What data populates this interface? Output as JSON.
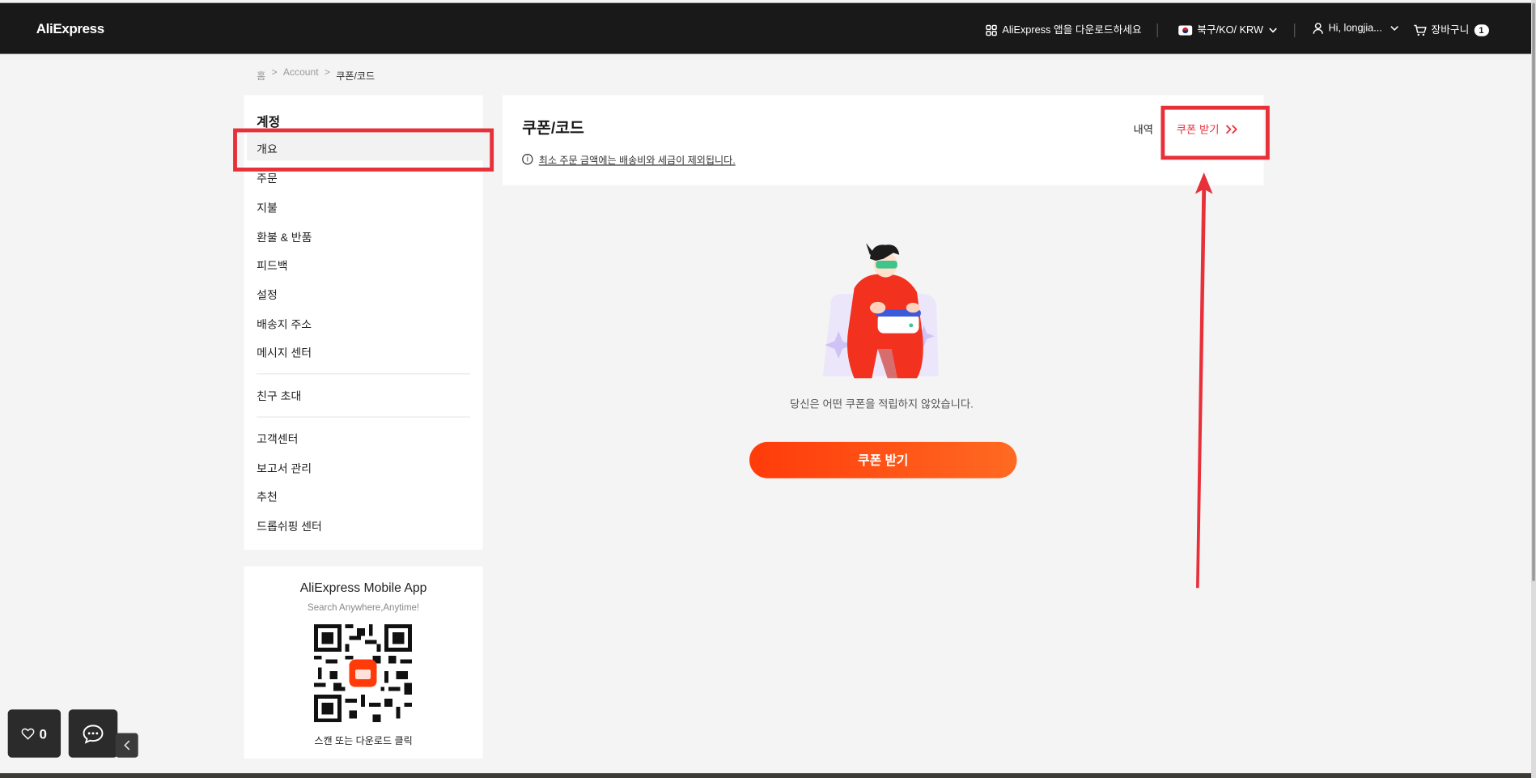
{
  "header": {
    "logo": "AliExpress",
    "app_download": "AliExpress 앱을 다운로드하세요",
    "locale": "북구/KO/ KRW",
    "user_greeting": "Hi, longjia...",
    "cart_label": "장바구니",
    "cart_count": "1"
  },
  "breadcrumb": {
    "home": "홈",
    "sep": ">",
    "account": "Account",
    "current": "쿠폰/코드"
  },
  "sidebar": {
    "title": "계정",
    "items": [
      "개요",
      "주문",
      "지불",
      "환불 & 반품",
      "피드백",
      "설정",
      "배송지 주소",
      "메시지 센터"
    ],
    "group2": [
      "친구 초대"
    ],
    "group3": [
      "고객센터",
      "보고서 관리",
      "추천",
      "드롭쉬핑 센터"
    ]
  },
  "app_promo": {
    "title": "AliExpress Mobile App",
    "subtitle": "Search Anywhere,Anytime!",
    "scan_text": "스캔 또는 다운로드 클릭"
  },
  "main": {
    "title": "쿠폰/코드",
    "notice": "최소 주문 금액에는 배송비와 세금이 제외됩니다.",
    "history_link": "내역",
    "get_coupon_link": "쿠폰 받기",
    "empty_message": "당신은 어떤 쿠폰을 적립하지 않았습니다.",
    "get_coupon_button": "쿠폰 받기"
  },
  "floating": {
    "wishlist_count": "0"
  },
  "colors": {
    "brand_red": "#e8303a",
    "header_bg": "#191919",
    "cta_start": "#ff3b0a",
    "cta_end": "#ff6a22"
  },
  "icons": [
    "app-grid-icon",
    "flag-icon",
    "chevron-down-icon",
    "user-icon",
    "cart-icon",
    "info-icon",
    "double-chevron-right-icon",
    "heart-icon",
    "chat-icon",
    "chevron-left-icon"
  ]
}
